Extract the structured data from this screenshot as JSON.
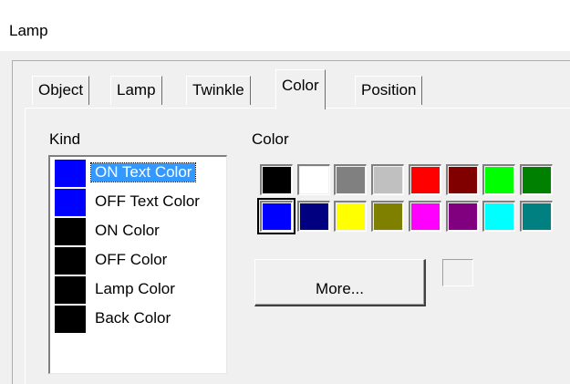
{
  "window": {
    "title": "Lamp"
  },
  "tabs": [
    {
      "label": "Object"
    },
    {
      "label": "Lamp"
    },
    {
      "label": "Twinkle"
    },
    {
      "label": "Color"
    },
    {
      "label": "Position"
    }
  ],
  "kind": {
    "label": "Kind",
    "items": [
      {
        "label": "ON Text Color",
        "color": "#0000ff"
      },
      {
        "label": "OFF Text Color",
        "color": "#0000ff"
      },
      {
        "label": "ON Color",
        "color": "#000000"
      },
      {
        "label": "OFF Color",
        "color": "#000000"
      },
      {
        "label": "Lamp Color",
        "color": "#000000"
      },
      {
        "label": "Back Color",
        "color": "#000000"
      }
    ]
  },
  "color_section": {
    "label": "Color",
    "palette": [
      "#000000",
      "#ffffff",
      "#808080",
      "#c0c0c0",
      "#ff0000",
      "#800000",
      "#00ff00",
      "#008000",
      "#0000ff",
      "#000080",
      "#ffff00",
      "#808000",
      "#ff00ff",
      "#800080",
      "#00ffff",
      "#008080"
    ],
    "more_label": "More..."
  }
}
